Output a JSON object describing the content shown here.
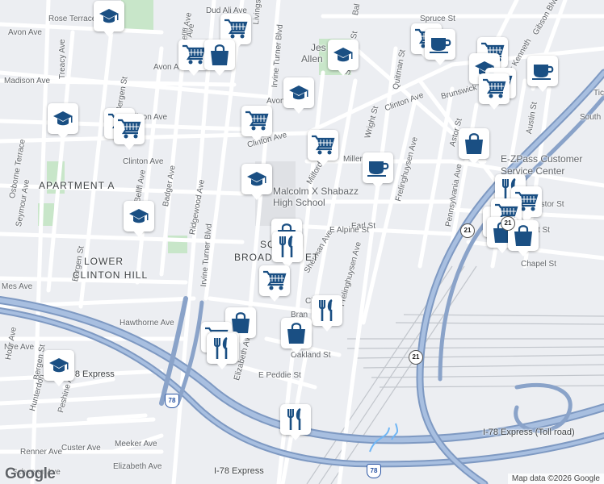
{
  "map": {
    "attribution": "Map data ©2026 Google",
    "logo": "Google"
  },
  "colors": {
    "background": "#eceef2",
    "road": "#ffffff",
    "highway": "#8aa3c9",
    "park": "#c8e6c9",
    "water": "#aadaff",
    "rail": "#c2c6cc",
    "marker_icon": "#1a4f83"
  },
  "streets": [
    {
      "name": "Rose Terrace",
      "angle": 0
    },
    {
      "name": "Avon Ave",
      "angle": 0
    },
    {
      "name": "Avon Ave",
      "angle": 0
    },
    {
      "name": "Avon Ave",
      "angle": 0
    },
    {
      "name": "Madison Ave",
      "angle": 0
    },
    {
      "name": "Madison Ave",
      "angle": 0
    },
    {
      "name": "Treacy Ave",
      "angle": -90
    },
    {
      "name": "Bergen St",
      "angle": -80
    },
    {
      "name": "Bergen St",
      "angle": -80
    },
    {
      "name": "Bergen St",
      "angle": -80
    },
    {
      "name": "Clinton Ave",
      "angle": 0
    },
    {
      "name": "Clinton Ave",
      "angle": -15
    },
    {
      "name": "Clinton Ave",
      "angle": -20
    },
    {
      "name": "Irvine Turner Blvd",
      "angle": -85
    },
    {
      "name": "Irvine Turner Blvd",
      "angle": -85
    },
    {
      "name": "Livingston",
      "angle": -85
    },
    {
      "name": "Bellfl Ave",
      "angle": -80
    },
    {
      "name": "Bellfl Ave",
      "angle": -80
    },
    {
      "name": "Badger Ave",
      "angle": -80
    },
    {
      "name": "Ridgewood Ave",
      "angle": -80
    },
    {
      "name": "Seymour Ave",
      "angle": -80
    },
    {
      "name": "Osborne Terrace",
      "angle": -80
    },
    {
      "name": "Hawthorne Ave",
      "angle": 0
    },
    {
      "name": "Nye Ave",
      "angle": 0
    },
    {
      "name": "I-78 Express",
      "angle": 0
    },
    {
      "name": "I-78 Express",
      "angle": 0
    },
    {
      "name": "I-78 Express (Toll road)",
      "angle": 0
    },
    {
      "name": "Hunterdon",
      "angle": -75
    },
    {
      "name": "Peshine Ave",
      "angle": -75
    },
    {
      "name": "Custer Ave",
      "angle": 0
    },
    {
      "name": "Renner Ave",
      "angle": 0
    },
    {
      "name": "Scheerer Ave",
      "angle": 0
    },
    {
      "name": "Meeker Ave",
      "angle": 0
    },
    {
      "name": "Elizabeth Ave",
      "angle": 0
    },
    {
      "name": "Elizabeth Ave",
      "angle": -75
    },
    {
      "name": "E Peddie St",
      "angle": 0
    },
    {
      "name": "Sherman Ave",
      "angle": -60
    },
    {
      "name": "Frelinghuysen Ave",
      "angle": -75
    },
    {
      "name": "Frelinghuysen Ave",
      "angle": -75
    },
    {
      "name": "Earl St",
      "angle": 0
    },
    {
      "name": "E Alpine St",
      "angle": 0
    },
    {
      "name": "Wright St",
      "angle": -75
    },
    {
      "name": "Wright St",
      "angle": 0
    },
    {
      "name": "Quitman St",
      "angle": -80
    },
    {
      "name": "Somerset St",
      "angle": -80
    },
    {
      "name": "Spruce St",
      "angle": 0
    },
    {
      "name": "Gibson Blvd",
      "angle": -60
    },
    {
      "name": "Mayor Kenneth",
      "angle": -60
    },
    {
      "name": "Brunswick",
      "angle": -15
    },
    {
      "name": "Astor St",
      "angle": -75
    },
    {
      "name": "Astor St",
      "angle": 0
    },
    {
      "name": "Austin St",
      "angle": -80
    },
    {
      "name": "Pennsylvania Ave",
      "angle": -80
    },
    {
      "name": "Miller",
      "angle": 0
    },
    {
      "name": "Milford",
      "angle": -60
    },
    {
      "name": "Bran",
      "angle": 0
    },
    {
      "name": "Clin",
      "angle": 0
    },
    {
      "name": "Oakland St",
      "angle": 0
    },
    {
      "name": "South",
      "angle": 0
    },
    {
      "name": "Tich",
      "angle": 0
    },
    {
      "name": "Chapel St",
      "angle": 0
    },
    {
      "name": "Mes Ave",
      "angle": 0
    },
    {
      "name": "Hour Ave",
      "angle": -80
    },
    {
      "name": "Bal",
      "angle": -80
    },
    {
      "name": "Dud Ali Ave",
      "angle": 0
    },
    {
      "name": "Gellif Ave",
      "angle": -80
    }
  ],
  "areas": [
    {
      "name": "APARTMENT A"
    },
    {
      "name": "LOWER"
    },
    {
      "name": "CLINTON HILL"
    },
    {
      "name": "SO"
    },
    {
      "name": "BROAD"
    },
    {
      "name": "ET"
    }
  ],
  "places": [
    {
      "name": "Malcolm X Shabazz"
    },
    {
      "name": "High School"
    },
    {
      "name": "Jes"
    },
    {
      "name": "Allen"
    },
    {
      "name": "E-ZPass Customer"
    },
    {
      "name": "Service Center"
    }
  ],
  "routes": [
    "21",
    "21",
    "78",
    "78",
    "21"
  ],
  "markers": [
    {
      "type": "school"
    },
    {
      "type": "shopping-cart"
    },
    {
      "type": "shopping-cart"
    },
    {
      "type": "shopping-bag"
    },
    {
      "type": "school"
    },
    {
      "type": "shopping-cart"
    },
    {
      "type": "shopping-cart"
    },
    {
      "type": "shopping-cart"
    },
    {
      "type": "school"
    },
    {
      "type": "shopping-cart"
    },
    {
      "type": "shopping-cart"
    },
    {
      "type": "coffee"
    },
    {
      "type": "school"
    },
    {
      "type": "shopping-cart"
    },
    {
      "type": "school"
    },
    {
      "type": "shopping-bag"
    },
    {
      "type": "shopping-cart"
    },
    {
      "type": "shopping-cart"
    },
    {
      "type": "coffee"
    },
    {
      "type": "shopping-bag"
    },
    {
      "type": "school"
    },
    {
      "type": "restaurant"
    },
    {
      "type": "shopping-cart"
    },
    {
      "type": "school"
    },
    {
      "type": "shopping-cart"
    },
    {
      "type": "shopping-bag"
    },
    {
      "type": "shopping-bag"
    },
    {
      "type": "coffee"
    },
    {
      "type": "shopping-bag"
    },
    {
      "type": "restaurant"
    },
    {
      "type": "shopping-cart"
    },
    {
      "type": "restaurant"
    },
    {
      "type": "shopping-bag"
    },
    {
      "type": "shopping-bag"
    },
    {
      "type": "shopping-cart"
    },
    {
      "type": "restaurant"
    },
    {
      "type": "restaurant"
    },
    {
      "type": "school"
    },
    {
      "type": "restaurant"
    }
  ]
}
